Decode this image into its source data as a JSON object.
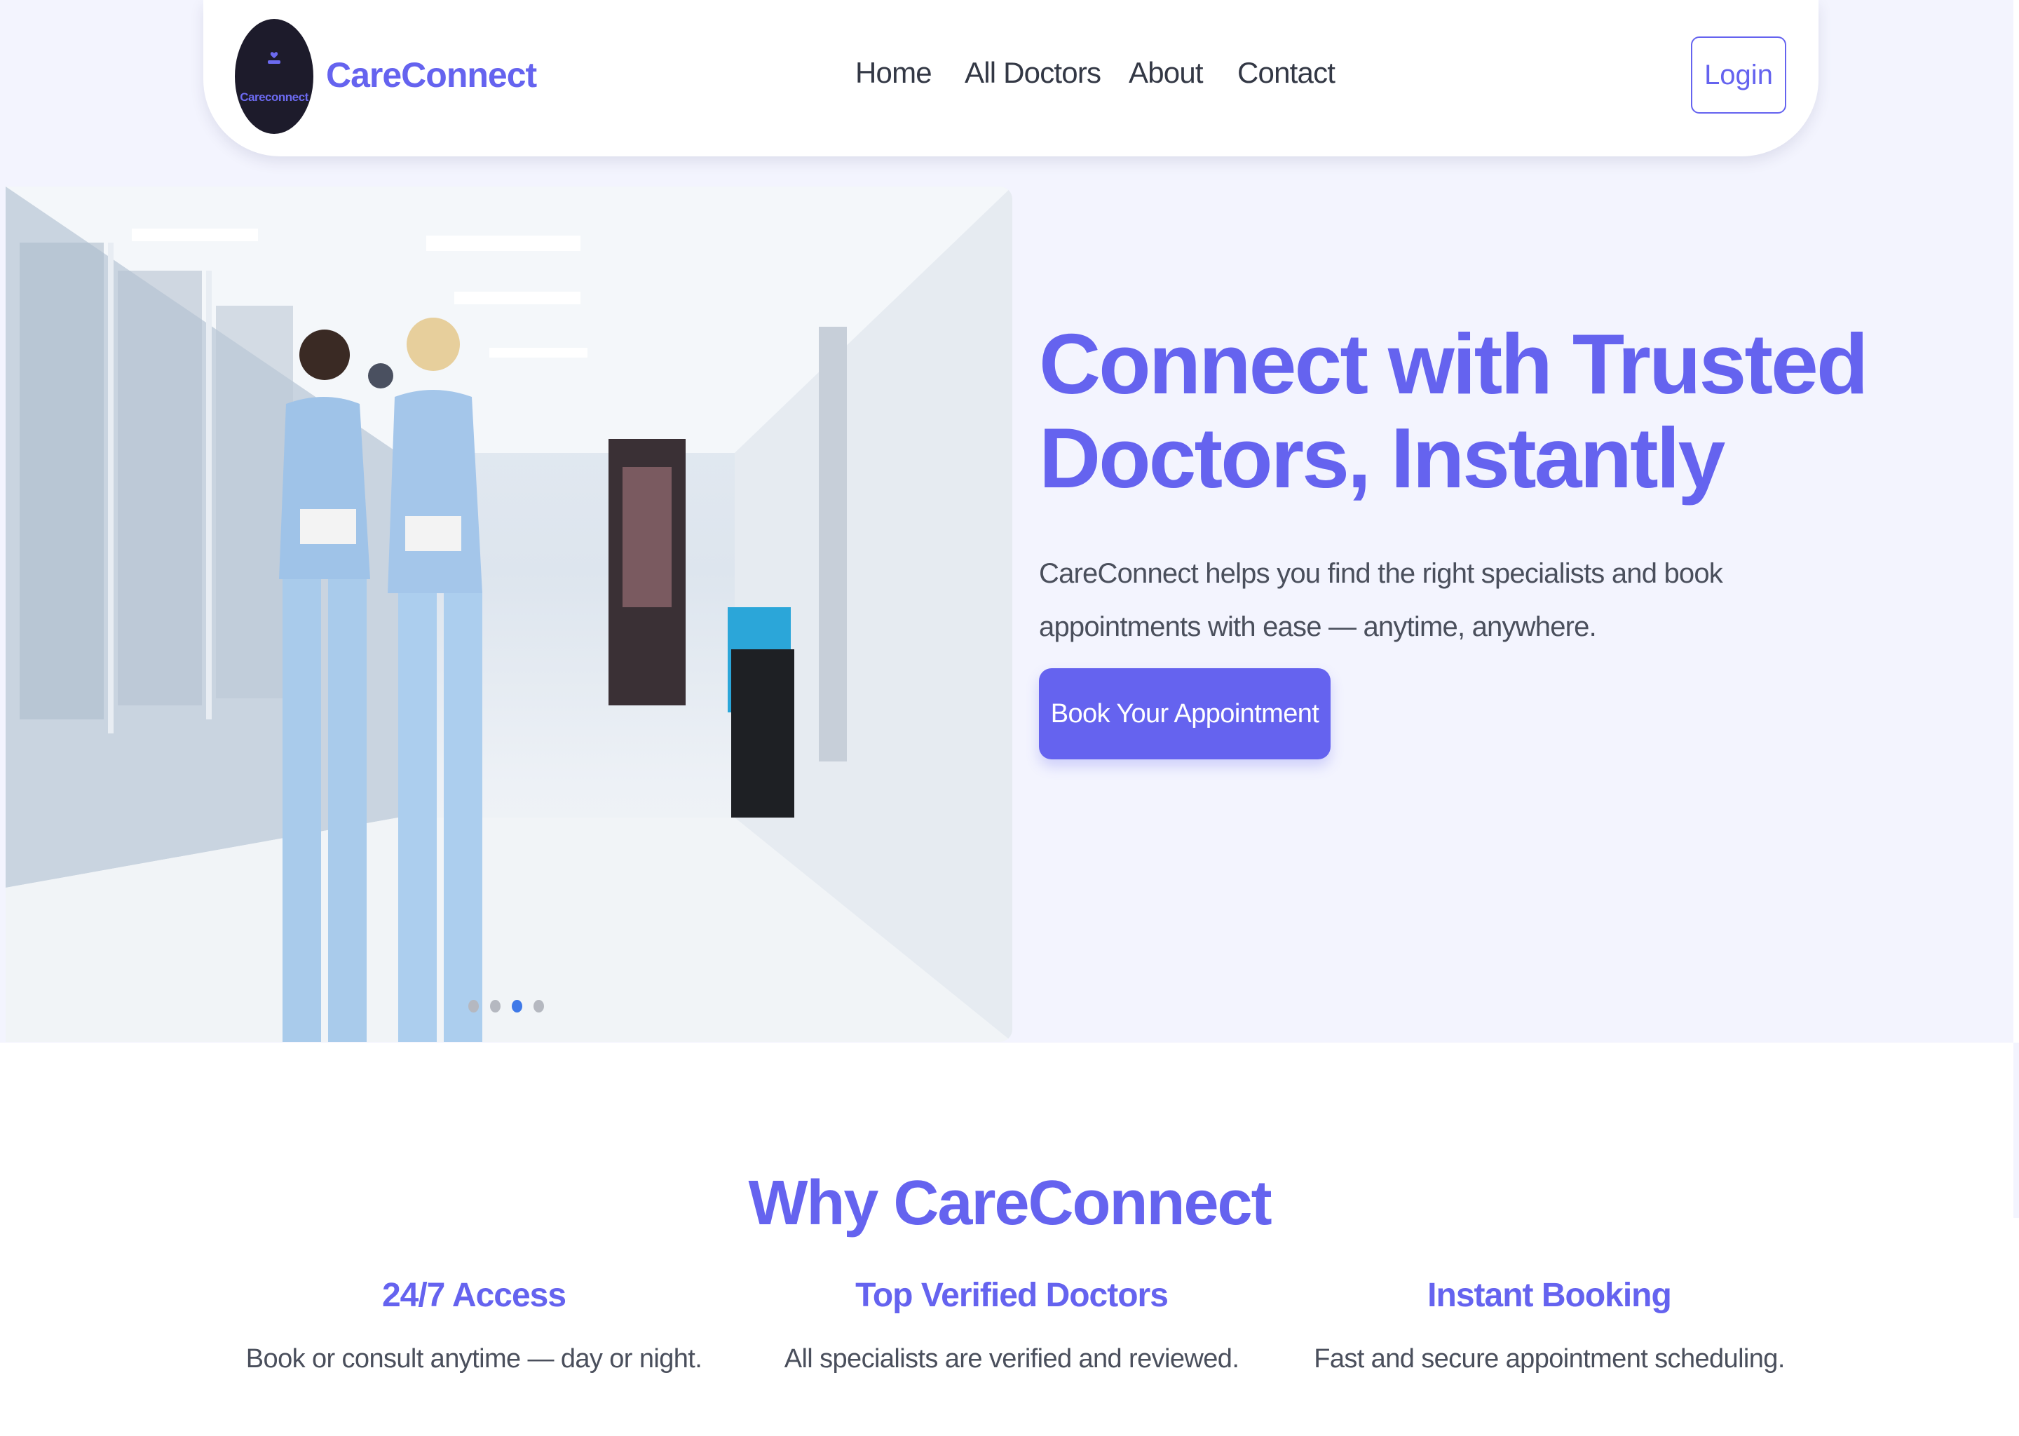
{
  "brand": {
    "name": "CareConnect",
    "logo_text": "Careconnect",
    "accent": "#6563ef"
  },
  "nav": {
    "items": [
      {
        "label": "Home"
      },
      {
        "label": "All Doctors"
      },
      {
        "label": "About"
      },
      {
        "label": "Contact"
      }
    ],
    "login_label": "Login"
  },
  "hero": {
    "title": "Connect with Trusted Doctors, Instantly",
    "subtitle": "CareConnect helps you find the right specialists and book appointments with ease — anytime, anywhere.",
    "cta_label": "Book Your Appointment",
    "carousel": {
      "slides": 4,
      "active_slide": 3
    }
  },
  "why": {
    "title": "Why CareConnect",
    "features": [
      {
        "title": "24/7 Access",
        "description": "Book or consult anytime — day or night."
      },
      {
        "title": "Top Verified Doctors",
        "description": "All specialists are verified and reviewed."
      },
      {
        "title": "Instant Booking",
        "description": "Fast and secure appointment scheduling."
      }
    ]
  }
}
